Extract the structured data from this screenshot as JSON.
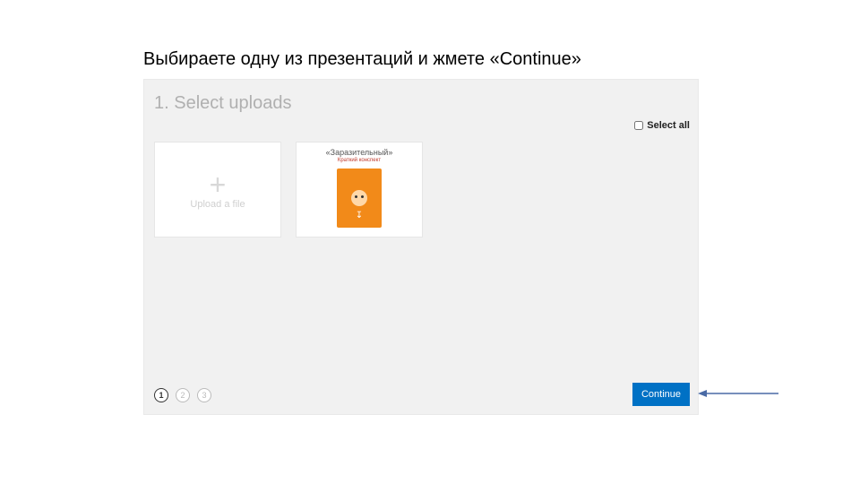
{
  "instruction": "Выбираете одну из презентаций и жмете «Continue»",
  "panel": {
    "heading": "1. Select uploads",
    "select_all_label": "Select all"
  },
  "upload_tile": {
    "plus": "+",
    "label": "Upload a file"
  },
  "presentation_tile": {
    "title": "«Заразительный»",
    "subtitle": "Краткий конспект"
  },
  "stepper": {
    "step1": "1",
    "step2": "2",
    "step3": "3"
  },
  "continue_label": "Continue"
}
